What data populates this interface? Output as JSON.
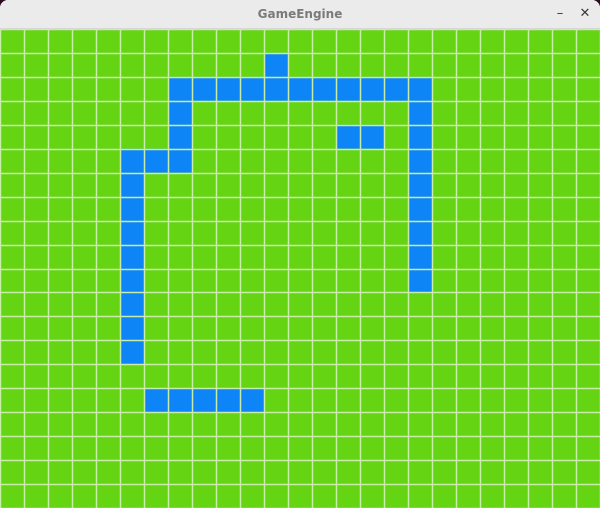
{
  "window": {
    "title": "GameEngine",
    "minimize_icon": "minimize-icon",
    "close_icon": "close-icon",
    "minimize_glyph": "–",
    "close_glyph": "✕"
  },
  "game": {
    "grid_columns": 25,
    "grid_rows": 20,
    "colors": {
      "background": "#64d413",
      "grid_line": "#c8ecaa",
      "block": "#0e85f7"
    },
    "blocks": [
      [
        11,
        1
      ],
      [
        7,
        2
      ],
      [
        8,
        2
      ],
      [
        9,
        2
      ],
      [
        10,
        2
      ],
      [
        11,
        2
      ],
      [
        12,
        2
      ],
      [
        13,
        2
      ],
      [
        14,
        2
      ],
      [
        15,
        2
      ],
      [
        16,
        2
      ],
      [
        17,
        2
      ],
      [
        7,
        3
      ],
      [
        17,
        3
      ],
      [
        7,
        4
      ],
      [
        14,
        4
      ],
      [
        15,
        4
      ],
      [
        17,
        4
      ],
      [
        5,
        5
      ],
      [
        6,
        5
      ],
      [
        7,
        5
      ],
      [
        17,
        5
      ],
      [
        5,
        6
      ],
      [
        17,
        6
      ],
      [
        5,
        7
      ],
      [
        17,
        7
      ],
      [
        5,
        8
      ],
      [
        17,
        8
      ],
      [
        5,
        9
      ],
      [
        17,
        9
      ],
      [
        5,
        10
      ],
      [
        17,
        10
      ],
      [
        5,
        11
      ],
      [
        5,
        12
      ],
      [
        5,
        13
      ],
      [
        6,
        15
      ],
      [
        7,
        15
      ],
      [
        8,
        15
      ],
      [
        9,
        15
      ],
      [
        10,
        15
      ]
    ]
  }
}
